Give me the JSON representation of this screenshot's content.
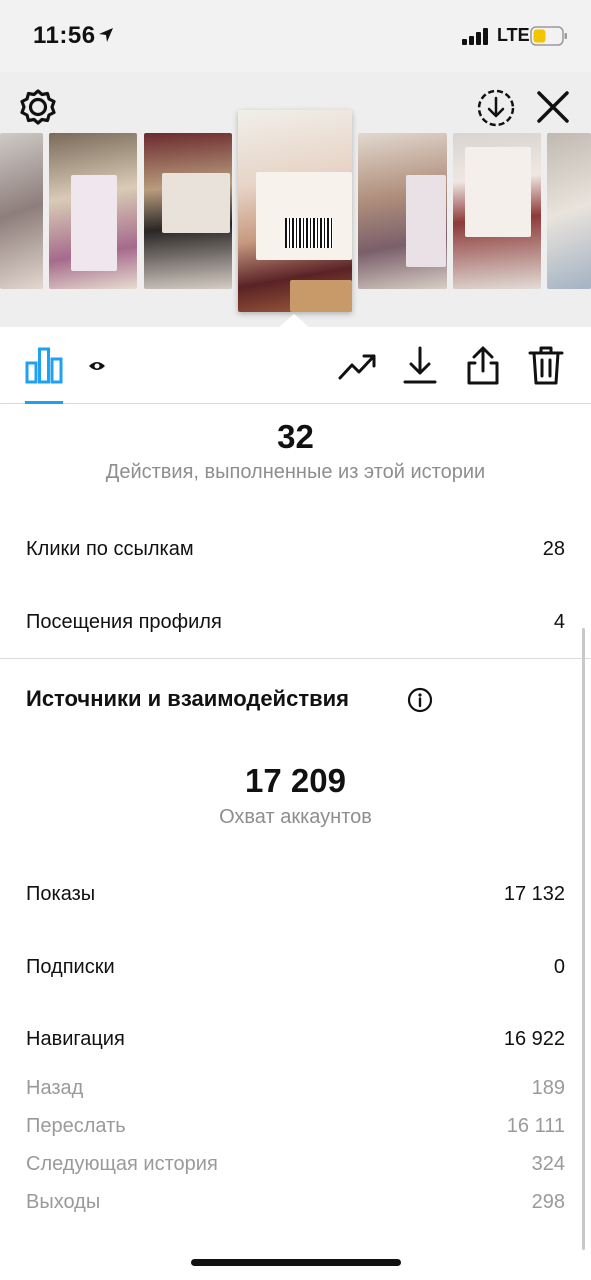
{
  "status_bar": {
    "time": "11:56",
    "network": "LTE",
    "battery_color": "#f5c400"
  },
  "icons": {
    "settings": "gear-icon",
    "save": "download-circle-icon",
    "close": "close-icon",
    "insights_tab": "bar-chart-icon",
    "viewers_tab": "eye-icon",
    "promote": "trending-up-icon",
    "download": "download-icon",
    "share": "share-icon",
    "delete": "trash-icon",
    "info": "info-icon"
  },
  "accent_color": "#1ea1f2",
  "actions": {
    "value": "32",
    "caption": "Действия, выполненные из этой истории",
    "rows": [
      {
        "label": "Клики по ссылкам",
        "value": "28"
      },
      {
        "label": "Посещения профиля",
        "value": "4"
      }
    ]
  },
  "discovery": {
    "title": "Источники и взаимодействия",
    "reach_value": "17 209",
    "reach_caption": "Охват аккаунтов",
    "rows": [
      {
        "label": "Показы",
        "value": "17 132"
      },
      {
        "label": "Подписки",
        "value": "0"
      },
      {
        "label": "Навигация",
        "value": "16 922"
      }
    ],
    "navigation_details": [
      {
        "label": "Назад",
        "value": "189"
      },
      {
        "label": "Переслать",
        "value": "16 111"
      },
      {
        "label": "Следующая история",
        "value": "324"
      },
      {
        "label": "Выходы",
        "value": "298"
      }
    ]
  }
}
